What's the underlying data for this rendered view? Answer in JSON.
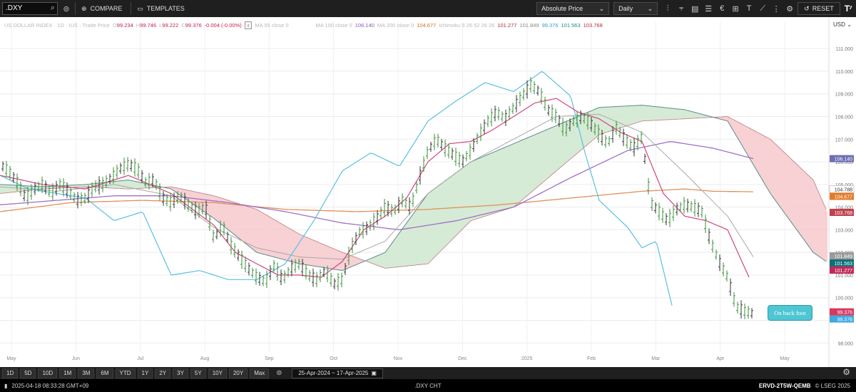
{
  "toolbar": {
    "symbol": ".DXY",
    "compare_label": "COMPARE",
    "templates_label": "TEMPLATES",
    "price_mode": "Absolute Price",
    "interval": "Daily",
    "reset_label": "RESET"
  },
  "legend": {
    "title": "US DOLLAR INDEX · 1D · IUS · Trade Price",
    "o_label": "O",
    "o_value": "99.234",
    "h_label": "H",
    "h_value": "99.746",
    "l_label": "L",
    "l_value": "99.222",
    "c_label": "C",
    "c_value": "99.376",
    "change": "-0.004 (-0.00%)",
    "collapse_glyph": "‹",
    "ma55": "MA 55 close 0",
    "ma100": "MA 100 close 0",
    "ma100_value": "106.140",
    "ma200": "MA 200 close 0",
    "ma200_value": "104.677",
    "ichimoku": "Ichimoku 9 26 52 26 26",
    "ich_v1": "101.277",
    "ich_v2": "101.849",
    "ich_v3": "99.376",
    "ich_v4": "101.563",
    "ich_v5": "103.768"
  },
  "currency": "USD",
  "annotation": "On back foot",
  "colors": {
    "price": "#555555",
    "tenkan": "#d0467c",
    "kijun": "#a8a8a8",
    "chikou": "#5bbfe3",
    "ma100": "#a070c8",
    "ma200": "#e0905a",
    "cloud_bull": "#cfe7cf",
    "cloud_bear": "#f6c9cc",
    "span_line": "#5c8a8a"
  },
  "periods": [
    "1D",
    "5D",
    "10D",
    "1M",
    "3M",
    "6M",
    "YTD",
    "1Y",
    "2Y",
    "3Y",
    "5Y",
    "10Y",
    "20Y",
    "Max"
  ],
  "date_range": "25-Apr-2024  ~  17-Apr-2025",
  "status": {
    "timestamp": "2025-04-18 08:33:28 GMT+09",
    "center": ".DXY CHT",
    "ric": "ERVD-2T5W-QEMB",
    "copyright": "© LSEG 2025"
  },
  "chart_data": {
    "type": "line",
    "title": "US DOLLAR INDEX",
    "ylim": [
      97.6,
      112.2
    ],
    "y_ticks": [
      98.0,
      99.0,
      100.0,
      101.0,
      102.0,
      103.0,
      104.0,
      105.0,
      106.0,
      107.0,
      108.0,
      109.0,
      110.0,
      111.0
    ],
    "x_ticks": [
      "May",
      "Jun",
      "Jul",
      "Aug",
      "Sep",
      "Oct",
      "Nov",
      "Dec",
      "2025",
      "Feb",
      "Mar",
      "Apr",
      "May"
    ],
    "price_badges": [
      {
        "label": "106.140",
        "value": 106.14,
        "series": "MA 100"
      },
      {
        "label": "104.788",
        "value": 104.79,
        "series": "price level"
      },
      {
        "label": "104.677",
        "value": 104.677,
        "series": "MA 200"
      },
      {
        "label": "103.768",
        "value": 103.768,
        "series": "Ichimoku span B"
      },
      {
        "label": "101.849",
        "value": 101.849,
        "series": "Kijun"
      },
      {
        "label": "101.563",
        "value": 101.563,
        "series": "Span A"
      },
      {
        "label": "101.277",
        "value": 101.277,
        "series": "Tenkan"
      },
      {
        "label": "99.376",
        "value": 99.376,
        "series": "Last close"
      },
      {
        "label": "99.376",
        "value": 99.376,
        "series": "Chikou"
      }
    ],
    "series": [
      {
        "name": "price",
        "x": [
          0,
          12,
          24,
          36,
          48,
          60,
          72,
          84,
          96,
          108,
          120,
          132,
          144,
          156,
          168,
          180,
          192,
          204,
          216,
          228,
          240,
          252,
          264,
          276,
          288,
          300,
          312,
          324,
          336,
          348,
          360,
          372,
          384,
          396,
          408,
          420,
          432,
          444,
          456,
          468,
          480,
          492,
          504,
          516,
          528,
          540,
          552,
          564,
          576,
          588,
          600,
          612,
          624,
          636,
          648,
          660,
          672,
          684,
          696,
          708,
          720,
          732,
          744,
          756,
          768,
          780,
          792,
          804,
          816,
          828,
          840,
          852,
          864,
          876,
          888,
          900,
          912,
          924,
          936,
          948,
          960,
          972,
          984,
          996,
          1008,
          1020,
          1032,
          1044,
          1056
        ],
        "values": [
          105.9,
          105.6,
          105.1,
          104.4,
          104.8,
          105.0,
          104.6,
          105.0,
          104.7,
          104.3,
          104.4,
          104.9,
          105.0,
          105.3,
          105.7,
          105.9,
          105.7,
          105.1,
          105.2,
          104.4,
          104.2,
          104.5,
          104.1,
          103.8,
          104.0,
          102.6,
          103.2,
          102.3,
          101.8,
          101.3,
          100.9,
          100.7,
          101.4,
          100.8,
          101.3,
          101.5,
          101.0,
          100.8,
          101.2,
          100.6,
          100.8,
          102.2,
          102.9,
          103.1,
          103.5,
          104.0,
          103.8,
          104.3,
          104.0,
          105.3,
          106.5,
          107.0,
          106.6,
          106.3,
          106.0,
          106.5,
          107.2,
          107.8,
          108.2,
          107.9,
          108.4,
          108.9,
          109.4,
          109.1,
          108.3,
          108.0,
          107.4,
          107.8,
          108.0,
          107.7,
          107.2,
          106.8,
          107.5,
          107.0,
          106.6,
          107.1,
          104.2,
          103.8,
          103.4,
          103.9,
          104.1,
          104.0,
          103.8,
          102.5,
          101.6,
          100.9,
          99.6,
          99.4,
          99.3
        ]
      },
      {
        "name": "tenkan",
        "x": [
          0,
          60,
          120,
          180,
          240,
          300,
          330,
          360,
          390,
          420,
          450,
          480,
          510,
          540,
          570,
          600,
          630,
          660,
          690,
          720,
          750,
          780,
          810,
          840,
          870,
          900,
          930,
          960,
          990,
          1020,
          1050
        ],
        "values": [
          105.4,
          105.0,
          104.8,
          105.4,
          104.6,
          103.2,
          102.0,
          101.5,
          101.0,
          101.0,
          100.9,
          101.6,
          103.0,
          103.6,
          104.4,
          106.0,
          106.8,
          106.9,
          107.4,
          108.0,
          108.6,
          108.8,
          108.2,
          107.9,
          107.3,
          106.9,
          104.6,
          103.6,
          103.4,
          103.0,
          100.9
        ]
      },
      {
        "name": "kijun",
        "x": [
          0,
          80,
          160,
          240,
          300,
          360,
          420,
          480,
          540,
          600,
          660,
          720,
          780,
          840,
          900,
          960,
          1020,
          1056
        ],
        "values": [
          104.9,
          104.7,
          105.0,
          104.5,
          103.1,
          102.2,
          101.8,
          101.7,
          102.5,
          104.6,
          106.0,
          107.0,
          108.0,
          108.1,
          107.3,
          105.5,
          103.6,
          101.8
        ]
      },
      {
        "name": "chikou",
        "x": [
          0,
          40,
          80,
          120,
          160,
          200,
          240,
          280,
          320,
          360,
          400,
          440,
          480,
          520,
          560,
          600,
          640,
          680,
          720,
          760,
          800,
          820,
          840,
          880,
          900,
          920,
          944
        ],
        "values": [
          105.4,
          104.8,
          104.6,
          104.4,
          103.4,
          103.8,
          101.0,
          101.2,
          100.8,
          100.8,
          101.5,
          103.4,
          105.6,
          106.4,
          105.8,
          107.8,
          108.7,
          109.5,
          109.1,
          110.0,
          108.9,
          106.4,
          104.3,
          103.1,
          102.2,
          102.5,
          99.4
        ]
      },
      {
        "name": "MA 100",
        "x": [
          0,
          80,
          160,
          240,
          320,
          400,
          480,
          560,
          640,
          720,
          800,
          880,
          940,
          1000,
          1056
        ],
        "values": [
          104.1,
          104.3,
          104.5,
          104.5,
          104.2,
          103.8,
          103.3,
          103.0,
          103.4,
          104.0,
          105.3,
          106.5,
          106.9,
          106.6,
          106.14
        ]
      },
      {
        "name": "MA 200",
        "x": [
          0,
          100,
          200,
          300,
          400,
          500,
          600,
          700,
          800,
          900,
          960,
          1000,
          1056
        ],
        "values": [
          103.8,
          104.2,
          104.3,
          104.2,
          103.9,
          103.8,
          103.9,
          104.1,
          104.4,
          104.7,
          104.8,
          104.7,
          104.677
        ]
      },
      {
        "name": "span A",
        "x": [
          0,
          60,
          120,
          180,
          240,
          300,
          360,
          420,
          480,
          540,
          600,
          660,
          720,
          780,
          840,
          900,
          960,
          1020,
          1080,
          1140,
          1160
        ],
        "values": [
          105.0,
          104.9,
          105.0,
          105.2,
          104.8,
          103.5,
          102.0,
          101.5,
          101.2,
          102.0,
          104.6,
          106.0,
          106.8,
          107.6,
          108.4,
          108.5,
          108.3,
          107.8,
          104.6,
          102.0,
          101.563
        ]
      },
      {
        "name": "span B",
        "x": [
          0,
          60,
          120,
          180,
          240,
          300,
          360,
          420,
          480,
          540,
          600,
          660,
          720,
          780,
          840,
          900,
          960,
          1020,
          1080,
          1140,
          1160
        ],
        "values": [
          104.6,
          104.8,
          104.9,
          104.8,
          104.9,
          104.5,
          103.9,
          102.8,
          102.0,
          101.3,
          101.5,
          103.4,
          104.0,
          105.6,
          107.2,
          107.8,
          107.9,
          108.0,
          107.0,
          105.2,
          103.768
        ]
      }
    ]
  }
}
